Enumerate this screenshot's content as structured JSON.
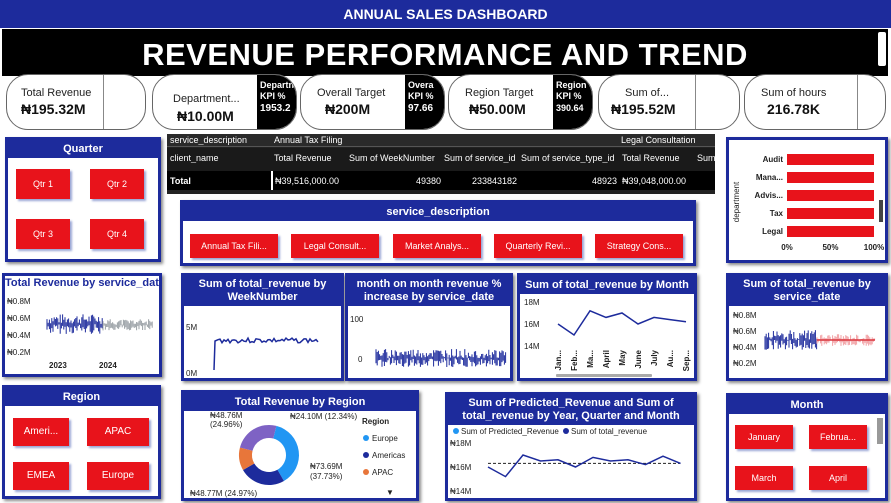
{
  "header": {
    "title": "ANNUAL SALES DASHBOARD",
    "banner": "REVENUE PERFORMANCE AND TREND"
  },
  "kpis": [
    {
      "label": "Total Revenue",
      "value": "₦195.32M"
    },
    {
      "label": "Department...",
      "value": "₦10.00M",
      "side_label": "Department KPI %",
      "side_value": "1953.2"
    },
    {
      "label": "Overall Target",
      "value": "₦200M",
      "side_label": "Overall KPI %",
      "side_value": "97.66%"
    },
    {
      "label": "Region Target",
      "value": "₦50.00M",
      "side_label": "Region KPI %",
      "side_value": "390.64%"
    },
    {
      "label": "Sum of...",
      "value": "₦195.52M"
    },
    {
      "label": "Sum of hours",
      "value": "216.78K"
    }
  ],
  "kpi_sides": [
    {
      "l1": "Departn",
      "l2": "KPI %",
      "v": "1953.2"
    },
    {
      "l1": "Overa",
      "l2": "KPI %",
      "v": "97.66"
    },
    {
      "l1": "Region",
      "l2": "KPI %",
      "v": "390.64"
    }
  ],
  "quarter_slicer": {
    "title": "Quarter",
    "items": [
      "Qtr 1",
      "Qtr 2",
      "Qtr 3",
      "Qtr 4"
    ]
  },
  "table": {
    "group_header": [
      "service_description",
      "Annual Tax Filing",
      "Legal Consultation"
    ],
    "columns": [
      "client_name",
      "Total Revenue",
      "Sum of WeekNumber",
      "Sum of service_id",
      "Sum of service_type_id",
      "Total Revenue",
      "Sum"
    ],
    "total_row": {
      "label": "Total",
      "total_revenue": "₦39,516,000.00",
      "week": "49380",
      "service_id": "233843182",
      "service_type_id": "48923",
      "total_revenue_2": "₦39,048,000.00"
    }
  },
  "service_slicer": {
    "title": "service_description",
    "items": [
      "Annual Tax Fili...",
      "Legal Consult...",
      "Market Analys...",
      "Quarterly Revi...",
      "Strategy Cons..."
    ]
  },
  "region_slicer": {
    "title": "Region",
    "items": [
      "Ameri...",
      "APAC",
      "EMEA",
      "Europe"
    ]
  },
  "month_slicer": {
    "title": "Month",
    "items": [
      "January",
      "Februa...",
      "March",
      "April"
    ]
  },
  "dept_chart": {
    "ylabel": "department",
    "categories": [
      "Audit",
      "Mana...",
      "Advis...",
      "Tax",
      "Legal"
    ],
    "ticks": [
      "0%",
      "50%",
      "100%"
    ],
    "color": "#e8131b"
  },
  "charts": {
    "rev_service_date_left": {
      "title": "Total Revenue by service_date",
      "yticks": [
        "₦0.8M",
        "₦0.6M",
        "₦0.4M",
        "₦0.2M"
      ],
      "xticks": [
        "2023",
        "2024"
      ]
    },
    "rev_week": {
      "title": "Sum of total_revenue by WeekNumber",
      "yticks": [
        "5M",
        "0M"
      ]
    },
    "mom": {
      "title": "month on month revenue % increase by service_date",
      "yticks": [
        "100",
        "0"
      ]
    },
    "rev_month": {
      "title": "Sum of total_revenue by Month",
      "yticks": [
        "18M",
        "16M",
        "14M"
      ],
      "xticks": [
        "Jan...",
        "Feb...",
        "Ma...",
        "April",
        "May",
        "June",
        "July",
        "Au...",
        "Sep..."
      ]
    },
    "rev_service_date_right": {
      "title": "Sum of total_revenue by service_date",
      "yticks": [
        "₦0.8M",
        "₦0.6M",
        "₦0.4M",
        "₦0.2M"
      ]
    },
    "donut": {
      "title": "Total Revenue by Region",
      "legend_title": "Region",
      "legend": [
        "Europe",
        "Americas",
        "APAC"
      ],
      "labels": [
        "₦48.76M (24.96%)",
        "₦24.10M (12.34%)",
        "₦73.69M (37.73%)",
        "₦48.77M (24.97%)"
      ]
    },
    "pred": {
      "title": "Sum of Predicted_Revenue and Sum of total_revenue by Year, Quarter and Month",
      "legend": [
        "Sum of Predicted_Revenue",
        "Sum of total_revenue"
      ],
      "yticks": [
        "₦18M",
        "₦16M",
        "₦14M"
      ]
    }
  },
  "chart_data": [
    {
      "type": "bar",
      "title": "",
      "xlabel": "",
      "ylabel": "department",
      "categories": [
        "Audit",
        "Mana...",
        "Advis...",
        "Tax",
        "Legal"
      ],
      "values": [
        1.0,
        1.0,
        1.0,
        1.0,
        1.0
      ],
      "ylim": [
        0,
        1
      ]
    },
    {
      "type": "line",
      "title": "Sum of total_revenue by Month",
      "categories": [
        "Jan...",
        "Feb...",
        "Ma...",
        "April",
        "May",
        "June",
        "July",
        "Au...",
        "Sep..."
      ],
      "values": [
        16.0,
        15.0,
        17.2,
        16.6,
        17.0,
        16.0,
        16.6,
        16.4,
        16.2
      ],
      "ylim": [
        14,
        18
      ]
    },
    {
      "type": "pie",
      "title": "Total Revenue by Region",
      "categories": [
        "Europe",
        "Americas",
        "APAC",
        "EMEA"
      ],
      "values": [
        73.69,
        48.77,
        24.1,
        48.76
      ]
    },
    {
      "type": "line",
      "title": "Sum of Predicted_Revenue and Sum of total_revenue by Year, Quarter and Month",
      "series": [
        {
          "name": "Sum of Predicted_Revenue",
          "values": [
            16.3,
            16.3,
            16.3,
            16.3,
            16.3,
            16.3,
            16.3,
            16.3,
            16.3,
            16.3,
            16.3,
            16.3
          ]
        },
        {
          "name": "Sum of total_revenue",
          "values": [
            16.0,
            15.2,
            17.0,
            16.5,
            16.6,
            16.0,
            16.8,
            16.5,
            16.6,
            16.2,
            16.9,
            16.3
          ]
        }
      ],
      "ylim": [
        14,
        18
      ]
    }
  ],
  "colors": {
    "navy": "#1d2b9c",
    "red": "#e8131b",
    "donut": [
      "#2196f3",
      "#1d2b9c",
      "#e8763a",
      "#7e62c4"
    ]
  }
}
